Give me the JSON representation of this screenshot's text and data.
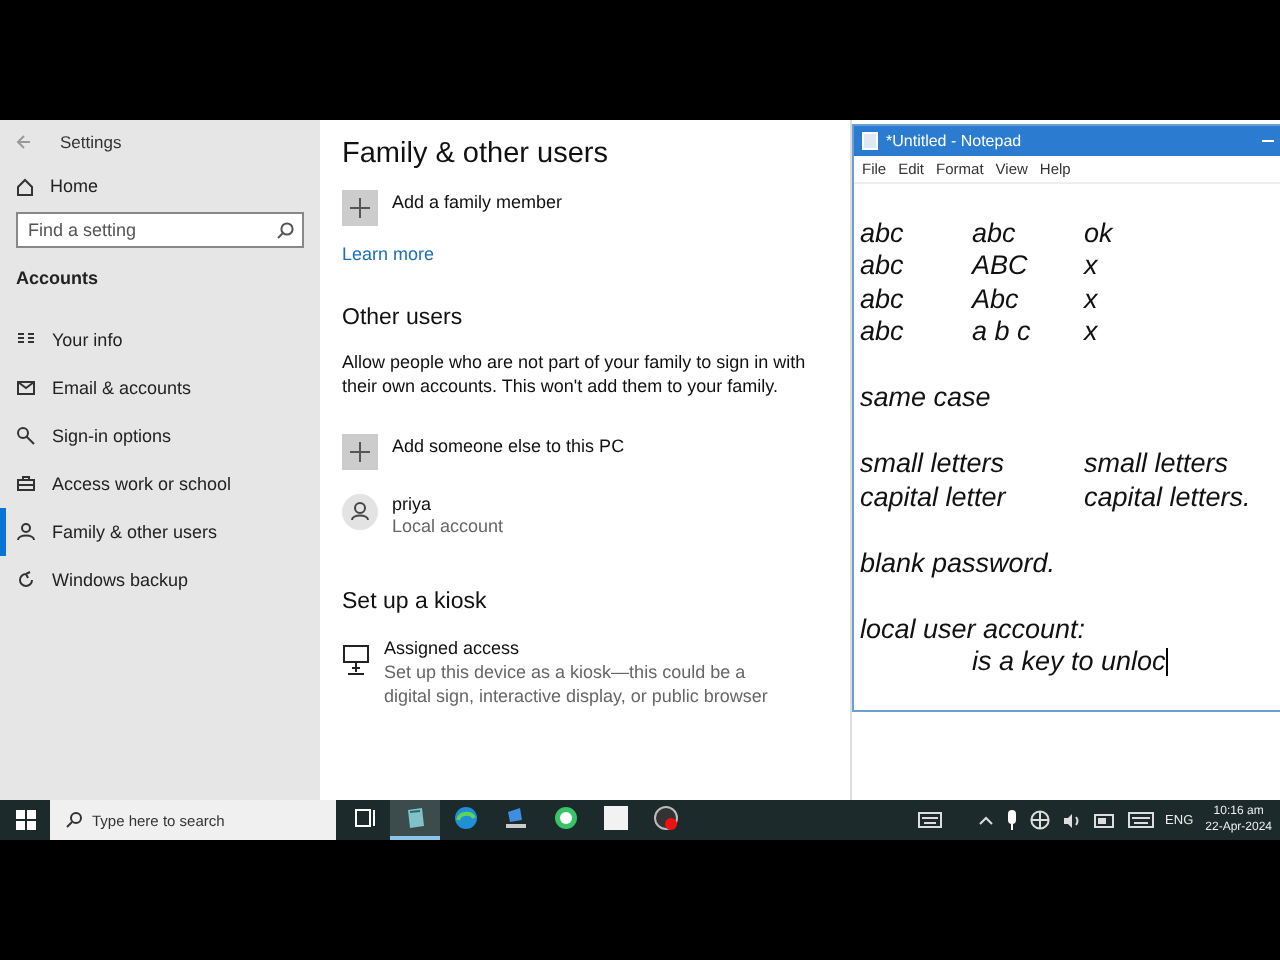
{
  "settings": {
    "title": "Settings",
    "home": "Home",
    "search": {
      "placeholder": "Find a setting"
    },
    "section": "Accounts",
    "nav": [
      {
        "label": "Your info",
        "selected": false
      },
      {
        "label": "Email & accounts",
        "selected": false
      },
      {
        "label": "Sign-in options",
        "selected": false
      },
      {
        "label": "Access work or school",
        "selected": false
      },
      {
        "label": "Family & other users",
        "selected": true
      },
      {
        "label": "Windows backup",
        "selected": false
      }
    ],
    "page": {
      "title": "Family & other users",
      "add_family": "Add a family member",
      "learn_more": "Learn more",
      "other_heading": "Other users",
      "other_text": "Allow people who are not part of your family to sign in with their own accounts. This won't add them to your family.",
      "add_other": "Add someone else to this PC",
      "users": [
        {
          "name": "priya",
          "type": "Local account"
        }
      ],
      "kiosk_heading": "Set up a kiosk",
      "kiosk_title": "Assigned access",
      "kiosk_text": "Set up this device as a kiosk—this could be a digital sign, interactive display, or public browser"
    }
  },
  "notepad": {
    "title": "*Untitled - Notepad",
    "menu": [
      "File",
      "Edit",
      "Format",
      "View",
      "Help"
    ],
    "paragraphs": [
      {
        "lines": [
          "abc\tabc\tok",
          "abc\tABC\tx",
          "abc\tAbc\tx",
          "abc\ta b c\tx"
        ]
      },
      {
        "lines": [
          "same case"
        ]
      },
      {
        "lines": [
          "small letters\tsmall letters",
          "capital letter\tcapital letters."
        ]
      },
      {
        "lines": [
          "blank password."
        ]
      },
      {
        "lines": [
          "local user account:",
          "\tis a key to unloc"
        ]
      }
    ]
  },
  "taskbar": {
    "search": {
      "placeholder": "Type here to search"
    },
    "apps": [
      {
        "kind": "taskview",
        "active": false
      },
      {
        "kind": "settings",
        "active": true
      },
      {
        "kind": "edge",
        "active": false
      },
      {
        "kind": "download",
        "active": false
      },
      {
        "kind": "chat",
        "active": false
      },
      {
        "kind": "notepad",
        "active": false
      },
      {
        "kind": "recorder",
        "active": false
      }
    ],
    "language": "ENG",
    "time": "10:16 am",
    "date": "22-Apr-2024"
  }
}
